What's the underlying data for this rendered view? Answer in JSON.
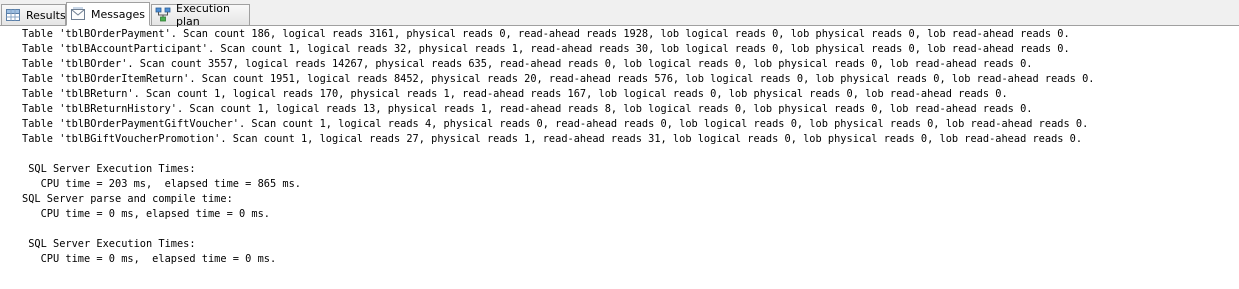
{
  "tabs": [
    {
      "label": "Results",
      "icon": "grid-icon"
    },
    {
      "label": "Messages",
      "icon": "messages-icon"
    },
    {
      "label": "Execution plan",
      "icon": "execution-plan-icon"
    }
  ],
  "active_tab": "Messages",
  "messages": [
    "Table 'tblBOrderPayment'. Scan count 186, logical reads 3161, physical reads 0, read-ahead reads 1928, lob logical reads 0, lob physical reads 0, lob read-ahead reads 0.",
    "Table 'tblBAccountParticipant'. Scan count 1, logical reads 32, physical reads 1, read-ahead reads 30, lob logical reads 0, lob physical reads 0, lob read-ahead reads 0.",
    "Table 'tblBOrder'. Scan count 3557, logical reads 14267, physical reads 635, read-ahead reads 0, lob logical reads 0, lob physical reads 0, lob read-ahead reads 0.",
    "Table 'tblBOrderItemReturn'. Scan count 1951, logical reads 8452, physical reads 20, read-ahead reads 576, lob logical reads 0, lob physical reads 0, lob read-ahead reads 0.",
    "Table 'tblBReturn'. Scan count 1, logical reads 170, physical reads 1, read-ahead reads 167, lob logical reads 0, lob physical reads 0, lob read-ahead reads 0.",
    "Table 'tblBReturnHistory'. Scan count 1, logical reads 13, physical reads 1, read-ahead reads 8, lob logical reads 0, lob physical reads 0, lob read-ahead reads 0.",
    "Table 'tblBOrderPaymentGiftVoucher'. Scan count 1, logical reads 4, physical reads 0, read-ahead reads 0, lob logical reads 0, lob physical reads 0, lob read-ahead reads 0.",
    "Table 'tblBGiftVoucherPromotion'. Scan count 1, logical reads 27, physical reads 1, read-ahead reads 31, lob logical reads 0, lob physical reads 0, lob read-ahead reads 0.",
    "",
    " SQL Server Execution Times:",
    "   CPU time = 203 ms,  elapsed time = 865 ms.",
    "SQL Server parse and compile time: ",
    "   CPU time = 0 ms, elapsed time = 0 ms.",
    "",
    " SQL Server Execution Times:",
    "   CPU time = 0 ms,  elapsed time = 0 ms."
  ],
  "colors": {
    "tabstrip_bg": "#f0f0f0",
    "tab_border": "#a0a0a0",
    "content_bg": "#ffffff",
    "text": "#000000"
  }
}
